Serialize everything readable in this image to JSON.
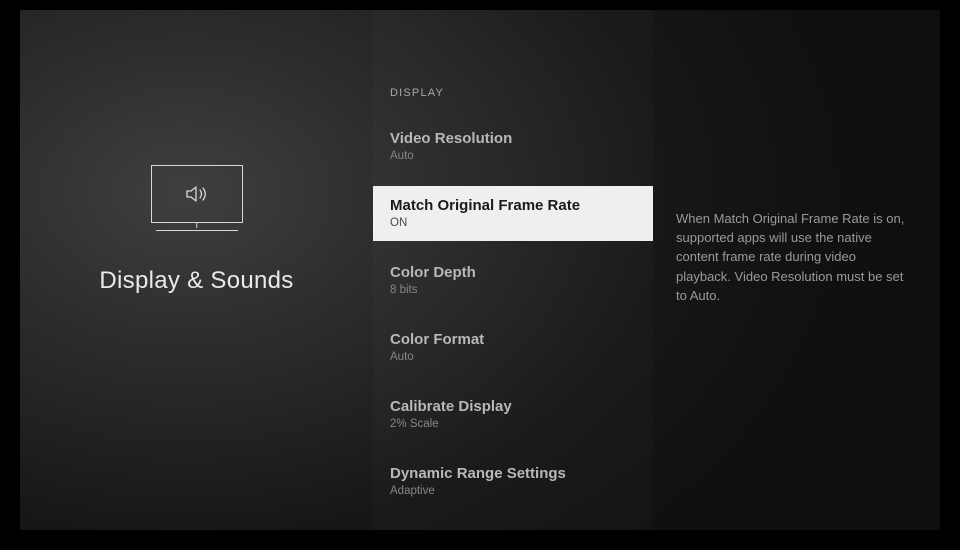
{
  "page": {
    "title": "Display & Sounds"
  },
  "section": {
    "header": "DISPLAY"
  },
  "settings": [
    {
      "title": "Video Resolution",
      "value": "Auto",
      "selected": false
    },
    {
      "title": "Match Original Frame Rate",
      "value": "ON",
      "selected": true
    },
    {
      "title": "Color Depth",
      "value": "8 bits",
      "selected": false
    },
    {
      "title": "Color Format",
      "value": "Auto",
      "selected": false
    },
    {
      "title": "Calibrate Display",
      "value": "2% Scale",
      "selected": false
    },
    {
      "title": "Dynamic Range Settings",
      "value": "Adaptive",
      "selected": false
    }
  ],
  "description": "When Match Original Frame Rate is on, supported apps will use the native content frame rate during video playback. Video Resolution must be set to Auto."
}
